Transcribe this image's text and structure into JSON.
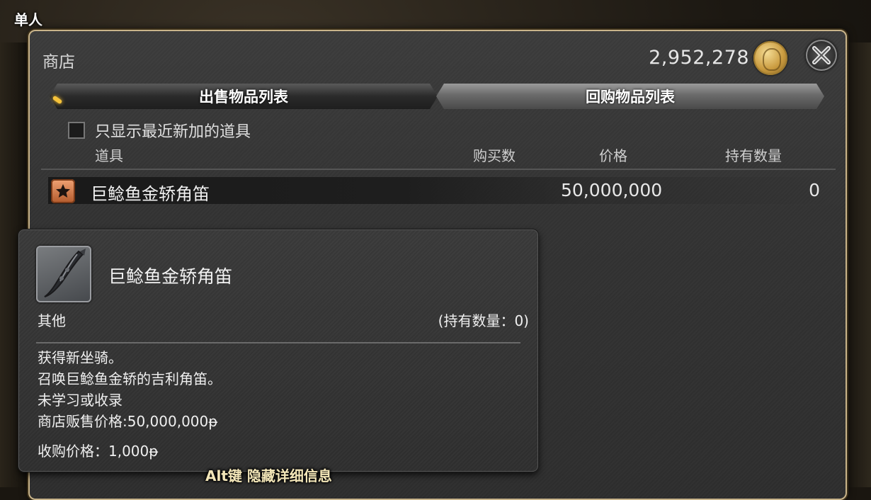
{
  "party": {
    "label": "单人"
  },
  "window": {
    "title": "商店",
    "gil": "2,952,278",
    "gil_icon": "gil-coin-icon",
    "close_icon": "close-icon"
  },
  "tabs": [
    {
      "label": "出售物品列表",
      "active": true
    },
    {
      "label": "回购物品列表",
      "active": false
    }
  ],
  "filter": {
    "label": "只显示最近新加的道具",
    "checked": false
  },
  "columns": {
    "item": "道具",
    "quantity": "购买数",
    "price": "价格",
    "owned": "持有数量"
  },
  "items": [
    {
      "icon": "star-icon",
      "name": "巨鲶鱼金轿角笛",
      "price": "50,000,000",
      "owned": "0"
    }
  ],
  "tooltip": {
    "name": "巨鲶鱼金轿角笛",
    "category": "其他",
    "owned": "(持有数量：0)",
    "lines": [
      "获得新坐骑。",
      "召唤巨鲶鱼金轿的吉利角笛。",
      "未学习或收录",
      "商店贩售价格:50,000,000ᵽ",
      "收购价格：1,000ᵽ"
    ],
    "hint": "Alt键 隐藏详细信息"
  }
}
